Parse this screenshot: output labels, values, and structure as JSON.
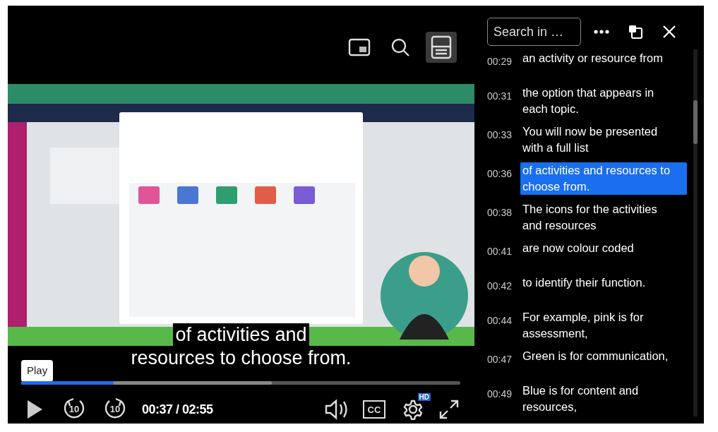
{
  "player_toolbar": [
    {
      "kind": "pip",
      "selected": false
    },
    {
      "kind": "search",
      "selected": false
    },
    {
      "kind": "transcript",
      "selected": true
    }
  ],
  "video": {
    "kind": "picture"
  },
  "captions": [
    "of activities and",
    "resources to choose from."
  ],
  "tooltip": "Play",
  "progress": {
    "level": 0.21,
    "buffered": {
      "level": 0.57
    }
  },
  "controls": {
    "skip_back": "10",
    "skip_forward": "10",
    "time": "00:37 / 02:55",
    "cc": "CC",
    "quality_badge": "HD"
  },
  "transcript": {
    "search": {
      "placeholder": "Search in …"
    },
    "rows": [
      {
        "time": "00:29",
        "text": "an activity or resource from",
        "selected": false
      },
      {
        "time": "00:31",
        "text": "the option that appears in each topic.",
        "selected": false
      },
      {
        "time": "00:33",
        "text": "You will now be presented with a full list",
        "selected": false
      },
      {
        "time": "00:36",
        "text": "of activities and resources to choose from.",
        "selected": true
      },
      {
        "time": "00:38",
        "text": "The icons for the activities and resources",
        "selected": false
      },
      {
        "time": "00:41",
        "text": "are now colour coded",
        "selected": false
      },
      {
        "time": "00:42",
        "text": "to identify their function.",
        "selected": false
      },
      {
        "time": "00:44",
        "text": "For example, pink is for assessment,",
        "selected": false
      },
      {
        "time": "00:47",
        "text": "Green is for communication,",
        "selected": false
      },
      {
        "time": "00:49",
        "text": "Blue is for content and resources,",
        "selected": false
      }
    ]
  }
}
